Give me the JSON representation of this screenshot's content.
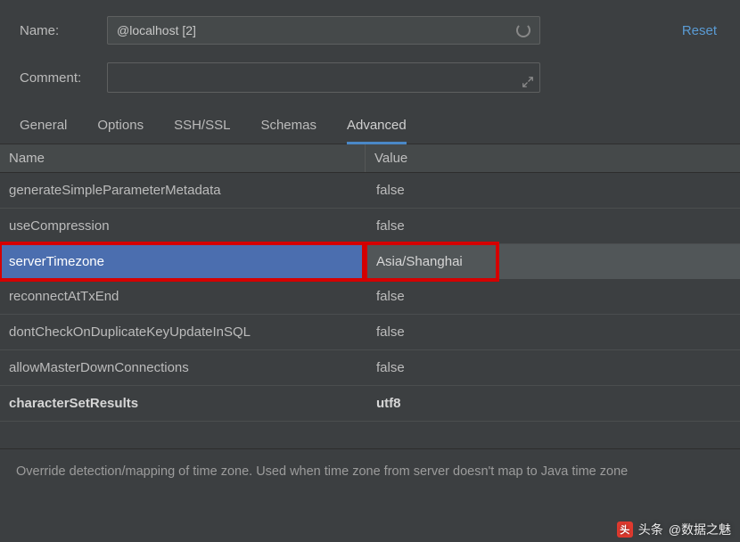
{
  "form": {
    "name_label": "Name:",
    "name_value": "@localhost [2]",
    "comment_label": "Comment:",
    "reset_label": "Reset"
  },
  "tabs": [
    {
      "label": "General",
      "active": false
    },
    {
      "label": "Options",
      "active": false
    },
    {
      "label": "SSH/SSL",
      "active": false
    },
    {
      "label": "Schemas",
      "active": false
    },
    {
      "label": "Advanced",
      "active": true
    }
  ],
  "table": {
    "header_name": "Name",
    "header_value": "Value",
    "rows": [
      {
        "name": "generateSimpleParameterMetadata",
        "value": "false",
        "selected": false,
        "bold": false
      },
      {
        "name": "useCompression",
        "value": "false",
        "selected": false,
        "bold": false
      },
      {
        "name": "serverTimezone",
        "value": "Asia/Shanghai",
        "selected": true,
        "bold": false
      },
      {
        "name": "reconnectAtTxEnd",
        "value": "false",
        "selected": false,
        "bold": false
      },
      {
        "name": "dontCheckOnDuplicateKeyUpdateInSQL",
        "value": "false",
        "selected": false,
        "bold": false
      },
      {
        "name": "allowMasterDownConnections",
        "value": "false",
        "selected": false,
        "bold": false
      },
      {
        "name": "characterSetResults",
        "value": "utf8",
        "selected": false,
        "bold": true
      }
    ]
  },
  "help_text": "Override detection/mapping of time zone. Used when time zone from server doesn't map to Java time zone",
  "watermark": {
    "prefix": "头条",
    "handle": "@数据之魅"
  }
}
